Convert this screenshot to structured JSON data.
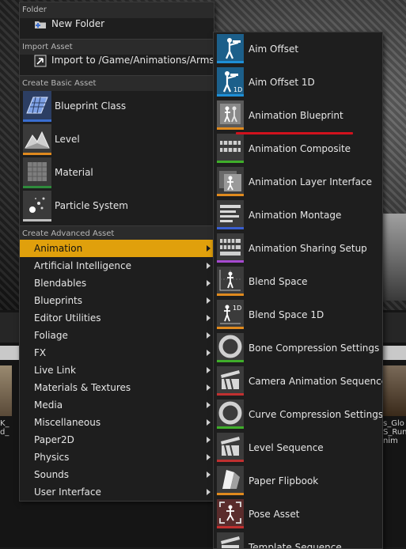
{
  "main_menu": {
    "sections": {
      "folder": "Folder",
      "import_asset": "Import Asset",
      "create_basic": "Create Basic Asset",
      "create_advanced": "Create Advanced Asset"
    },
    "new_folder": "New Folder",
    "import_to": "Import to /Game/Animations/Arms...",
    "basic_assets": [
      {
        "label": "Blueprint Class",
        "icon": "blueprint-class-icon",
        "color": "#3a6ed0"
      },
      {
        "label": "Level",
        "icon": "level-icon",
        "color": "#e08a1e"
      },
      {
        "label": "Material",
        "icon": "material-icon",
        "color": "#2e8b3c"
      },
      {
        "label": "Particle System",
        "icon": "particle-system-icon",
        "color": "#c0c0c0"
      }
    ],
    "advanced_items": [
      "Animation",
      "Artificial Intelligence",
      "Blendables",
      "Blueprints",
      "Editor Utilities",
      "Foliage",
      "FX",
      "Live Link",
      "Materials & Textures",
      "Media",
      "Miscellaneous",
      "Paper2D",
      "Physics",
      "Sounds",
      "User Interface"
    ],
    "active_item": "Animation",
    "highlight_color": "#e0a00c"
  },
  "animation_submenu": [
    {
      "label": "Aim Offset",
      "icon": "aim-offset-icon",
      "color": "#1e8fd6"
    },
    {
      "label": "Aim Offset 1D",
      "icon": "aim-offset-1d-icon",
      "color": "#1e8fd6"
    },
    {
      "label": "Animation Blueprint",
      "icon": "animation-blueprint-icon",
      "color": "#e08a1e"
    },
    {
      "label": "Animation Composite",
      "icon": "animation-composite-icon",
      "color": "#3fae2a"
    },
    {
      "label": "Animation Layer Interface",
      "icon": "animation-layer-interface-icon",
      "color": "#e08a1e"
    },
    {
      "label": "Animation Montage",
      "icon": "animation-montage-icon",
      "color": "#3a5fd0"
    },
    {
      "label": "Animation Sharing Setup",
      "icon": "animation-sharing-setup-icon",
      "color": "#a64ad0"
    },
    {
      "label": "Blend Space",
      "icon": "blend-space-icon",
      "color": "#e08a1e"
    },
    {
      "label": "Blend Space 1D",
      "icon": "blend-space-1d-icon",
      "color": "#e08a1e"
    },
    {
      "label": "Bone Compression Settings",
      "icon": "bone-compression-settings-icon",
      "color": "#3fae2a"
    },
    {
      "label": "Camera Animation Sequence",
      "icon": "camera-animation-sequence-icon",
      "color": "#c03030"
    },
    {
      "label": "Curve Compression Settings",
      "icon": "curve-compression-settings-icon",
      "color": "#3fae2a"
    },
    {
      "label": "Level Sequence",
      "icon": "level-sequence-icon",
      "color": "#c03030"
    },
    {
      "label": "Paper Flipbook",
      "icon": "paper-flipbook-icon",
      "color": "#e08a1e"
    },
    {
      "label": "Pose Asset",
      "icon": "pose-asset-icon",
      "color": "#c03030"
    },
    {
      "label": "Template Sequence",
      "icon": "template-sequence-icon",
      "color": "#c03030"
    }
  ],
  "background": {
    "thumb_left_caption": "K_\nd_",
    "thumb_right_caption": "s_Glo\nS_Run\nnim"
  },
  "annotation_color": "#d1121d"
}
